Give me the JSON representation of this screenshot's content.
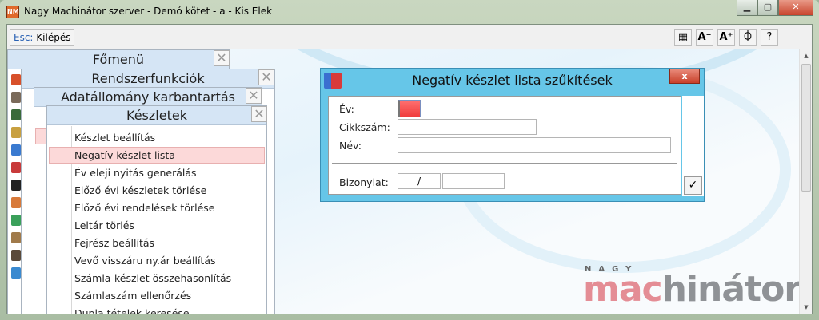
{
  "window": {
    "title": "Nagy Machinátor szerver - Demó kötet - a - Kis Elek",
    "app_icon": "NM",
    "minimize": "▁",
    "maximize": "▢",
    "close": "✕"
  },
  "toolbar": {
    "esc_key": "Esc:",
    "esc_label": "Kilépés",
    "buttons": [
      {
        "icon": "grid-icon",
        "label": "▦"
      },
      {
        "icon": "font-decrease-icon",
        "label": "A⁻"
      },
      {
        "icon": "font-increase-icon",
        "label": "A⁺"
      },
      {
        "icon": "lifebuoy-icon",
        "label": "⏀"
      },
      {
        "icon": "help-icon",
        "label": "?"
      }
    ]
  },
  "panels": {
    "fomenu": "Főmenü",
    "rendszer": "Rendszerfunkciók",
    "adat": "Adatállomány karbantartás",
    "keszletek": "Készletek",
    "close": "✕"
  },
  "menu_items": [
    "Készlet beállítás",
    "Negatív készlet lista",
    "Év eleji nyitás generálás",
    "Előző évi készletek törlése",
    "Előző évi rendelések törlése",
    "Leltár törlés",
    "Fejrész beállítás",
    "Vevő visszáru ny.ár beállítás",
    "Számla-készlet összehasonlítás",
    "Számlaszám ellenőrzés",
    "Dupla tételek keresése"
  ],
  "selected_item": "Negatív készlet lista",
  "dialog": {
    "title": "Negatív készlet lista szűkítések",
    "close": "x",
    "ev_label": "Év:",
    "cikkszam_label": "Cikkszám:",
    "cikkszam_value": "",
    "nev_label": "Név:",
    "nev_value": "",
    "bizonylat_label": "Bizonylat:",
    "bizonylat_value1": "/",
    "bizonylat_value2": "",
    "ok": "✓"
  },
  "logo": {
    "top": "NAGY",
    "part1": "mac",
    "part2": "hinátor"
  },
  "colors": {
    "selection": "#fcd9d9",
    "dialog_title": "#66c6e8",
    "logo_pink": "#e48d95"
  }
}
